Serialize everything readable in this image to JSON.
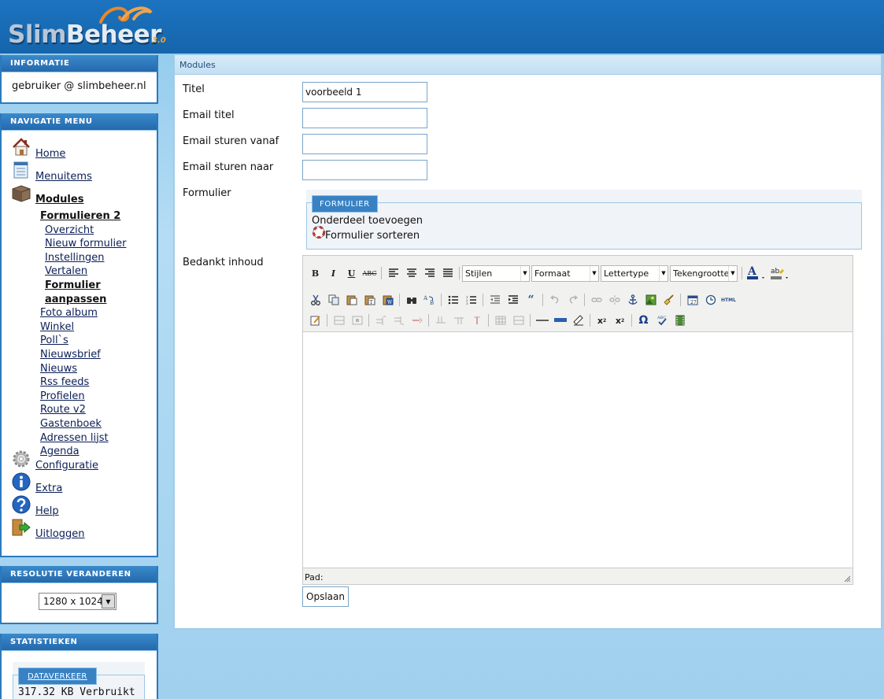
{
  "app": {
    "logo_main": "Slim",
    "logo_accent": "Beheer",
    "logo_version": "3.0"
  },
  "info": {
    "title": "INFORMATIE",
    "user": "gebruiker @ slimbeheer.nl"
  },
  "nav": {
    "title": "NAVIGATIE MENU",
    "home": "Home",
    "menuitems": "Menuitems",
    "modules": "Modules",
    "formulieren": "Formulieren 2",
    "form_sub": [
      "Overzicht",
      "Nieuw formulier",
      "Instellingen",
      "Vertalen"
    ],
    "form_active_1": "Formulier",
    "form_active_2": "aanpassen",
    "module_list": [
      "Foto album",
      "Winkel",
      "Poll`s",
      "Nieuwsbrief",
      "Nieuws",
      "Rss feeds",
      "Profielen",
      "Route v2",
      "Gastenboek",
      "Adressen lijst",
      "Agenda"
    ],
    "configuratie": "Configuratie",
    "extra": "Extra",
    "help": "Help",
    "uitloggen": "Uitloggen"
  },
  "resolution": {
    "title": "RESOLUTIE VERANDEREN",
    "value": "1280 x 1024"
  },
  "stats": {
    "title": "STATISTIEKEN",
    "legend": "DATAVERKEER",
    "value": "317.32 KB Verbruikt"
  },
  "main": {
    "title": "Modules",
    "fields": {
      "titel_label": "Titel",
      "titel_value": "voorbeeld 1",
      "email_titel_label": "Email titel",
      "email_vanaf_label": "Email sturen vanaf",
      "email_naar_label": "Email sturen naar",
      "formulier_label": "Formulier",
      "bedankt_label": "Bedankt inhoud"
    },
    "fieldset": {
      "legend": "FORMULIER",
      "item1": "Onderdeel toevoegen",
      "item2": "Formulier sorteren"
    },
    "editor": {
      "bold": "B",
      "italic": "I",
      "underline": "U",
      "strike": "ABC",
      "styles": "Stijlen",
      "format": "Formaat",
      "font": "Lettertype",
      "size": "Tekengrootte",
      "html_label": "HTML",
      "path_label": "Pad:"
    },
    "save_label": "Opslaan"
  }
}
